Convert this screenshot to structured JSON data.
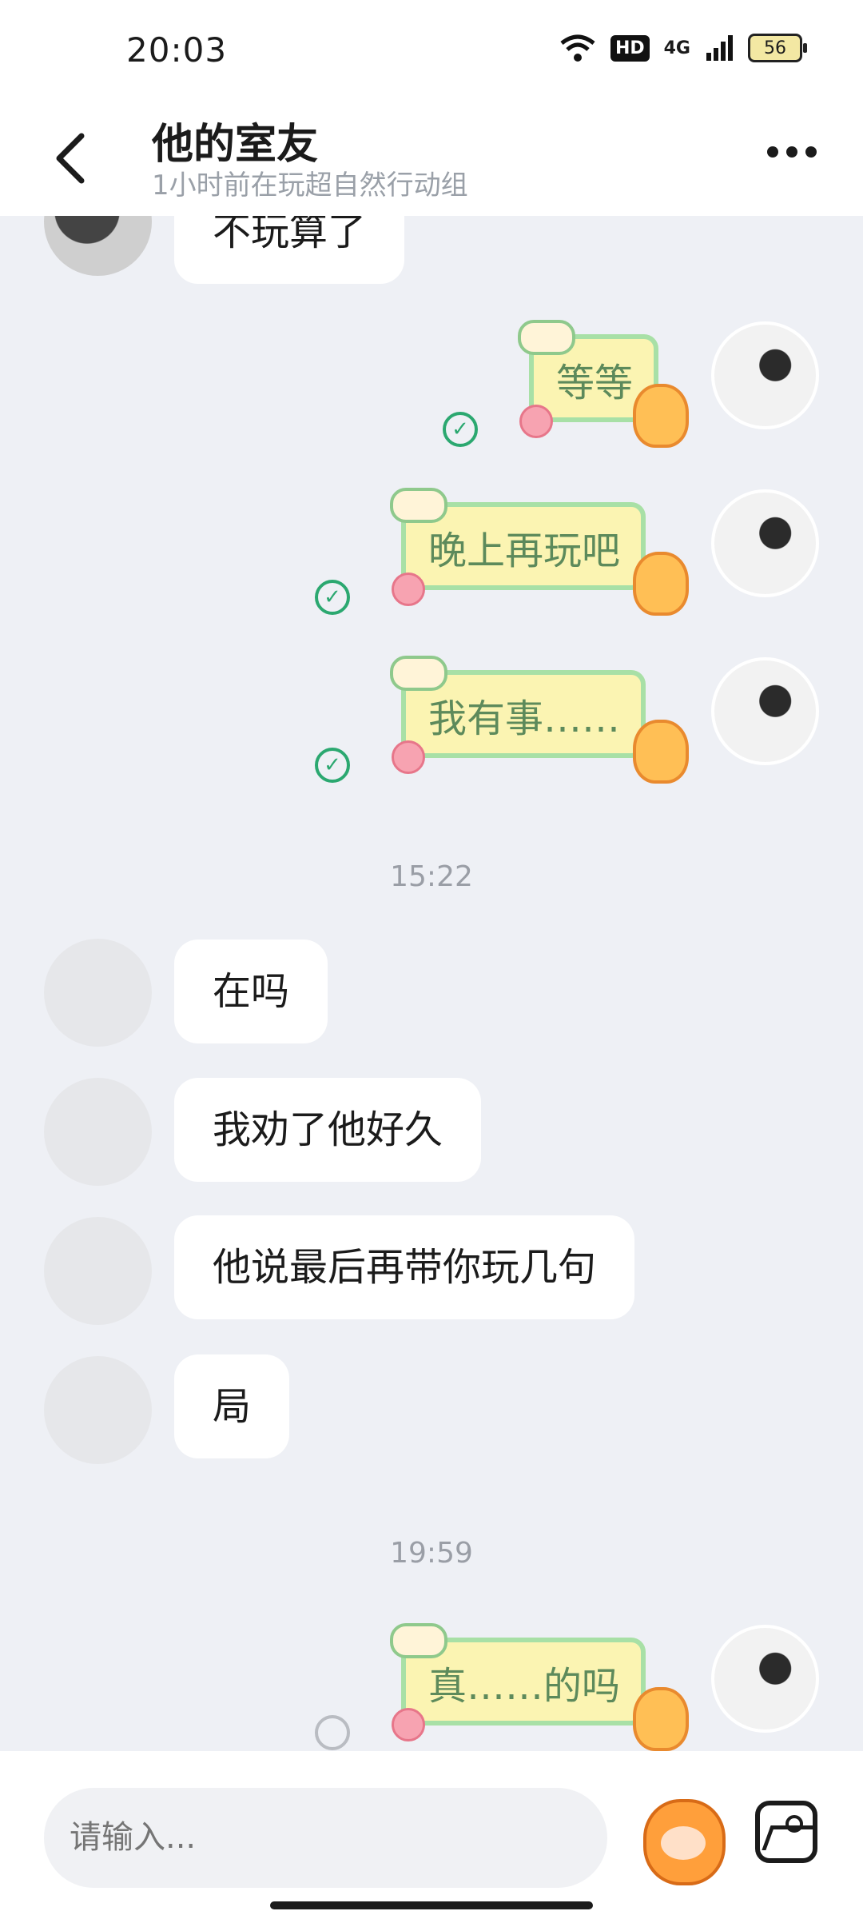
{
  "status": {
    "time": "20:03",
    "hd": "HD",
    "network": "4G",
    "battery": "56"
  },
  "header": {
    "title": "他的室友",
    "subtitle": "1小时前在玩超自然行动组"
  },
  "messages": {
    "top_partial": "不玩算了",
    "r1": "等等",
    "r2": "晚上再玩吧",
    "r3": "我有事……",
    "ts1": "15:22",
    "l1": "在吗",
    "l2": "我劝了他好久",
    "l3": "他说最后再带你玩几句",
    "l4": "局",
    "ts2": "19:59",
    "r4": "真……的吗"
  },
  "input": {
    "placeholder": "请输入..."
  },
  "icons": {
    "back": "back-icon",
    "more": "more-icon",
    "mascot": "mascot-sticker-icon",
    "image": "image-icon"
  },
  "colors": {
    "sent_bubble_fill": "#fbf4b2",
    "sent_bubble_border": "#a8e0a6",
    "sent_text": "#5d8a5b",
    "read_check": "#2ba870"
  }
}
